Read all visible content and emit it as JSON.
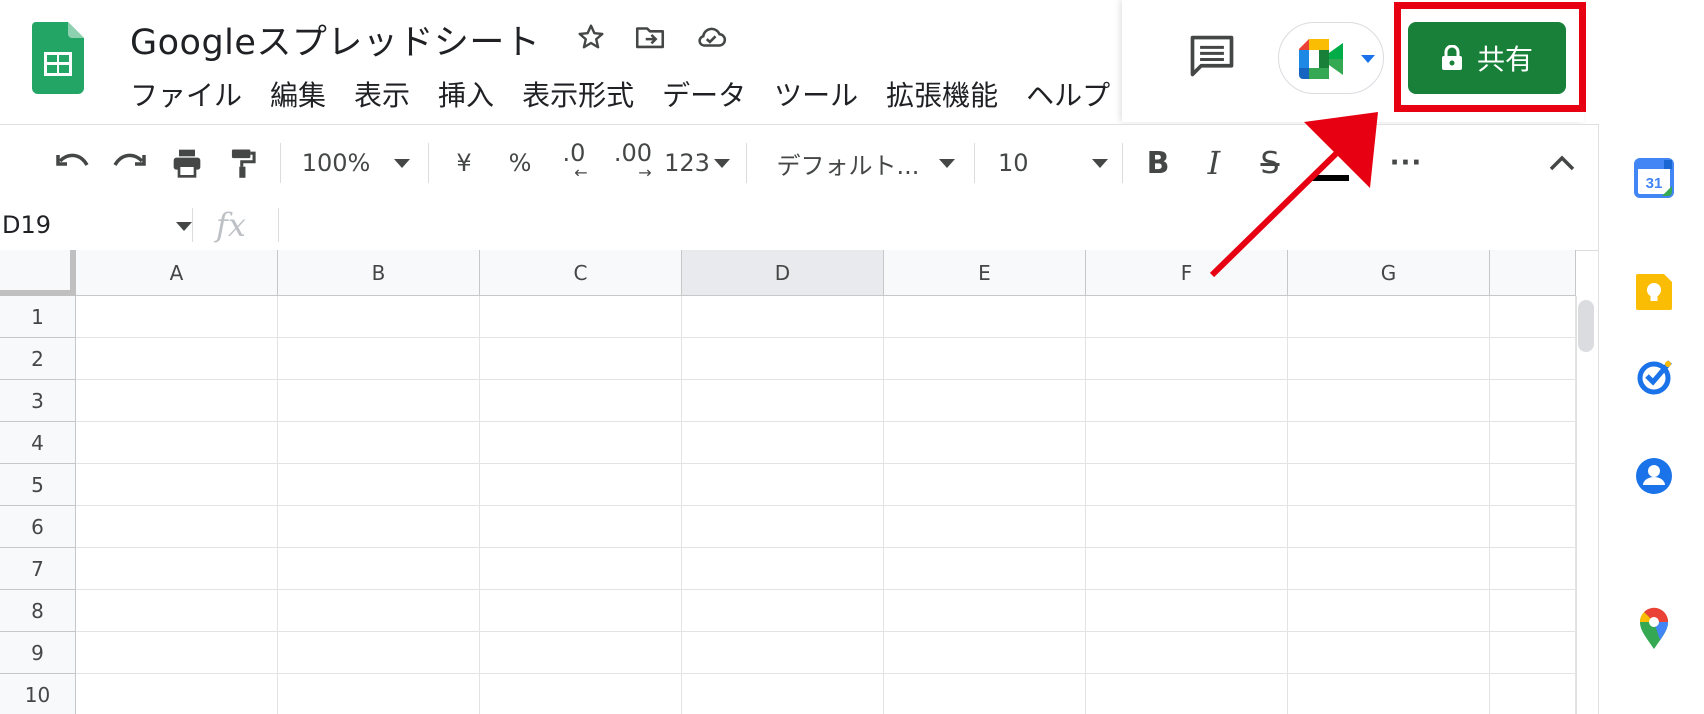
{
  "app": {
    "title": "Googleスプレッドシート"
  },
  "header": {
    "icons": [
      "star-icon",
      "move-to-folder-icon",
      "cloud-saved-icon"
    ],
    "menu": [
      "ファイル",
      "編集",
      "表示",
      "挿入",
      "表示形式",
      "データ",
      "ツール",
      "拡張機能",
      "ヘルプ"
    ],
    "share_label": "共有",
    "share_color": "#188038",
    "highlight_color": "#e60012"
  },
  "toolbar": {
    "zoom": "100%",
    "currency": "¥",
    "percent": "%",
    "decrease_decimal": ".0",
    "increase_decimal": ".00",
    "number_format": "123",
    "font": "デフォルト...",
    "font_size": "10",
    "bold": "B",
    "italic": "I",
    "strikethrough": "S",
    "more": "···"
  },
  "formula_bar": {
    "name_box": "D19",
    "fx": "fx"
  },
  "grid": {
    "columns": [
      "A",
      "B",
      "C",
      "D",
      "E",
      "F",
      "G"
    ],
    "rows": [
      "1",
      "2",
      "3",
      "4",
      "5",
      "6",
      "7",
      "8",
      "9",
      "10"
    ],
    "selected_column": "D"
  },
  "side_panel": {
    "apps": [
      "calendar-icon",
      "keep-icon",
      "tasks-icon",
      "contacts-icon",
      "maps-icon"
    ],
    "calendar_day": "31"
  }
}
